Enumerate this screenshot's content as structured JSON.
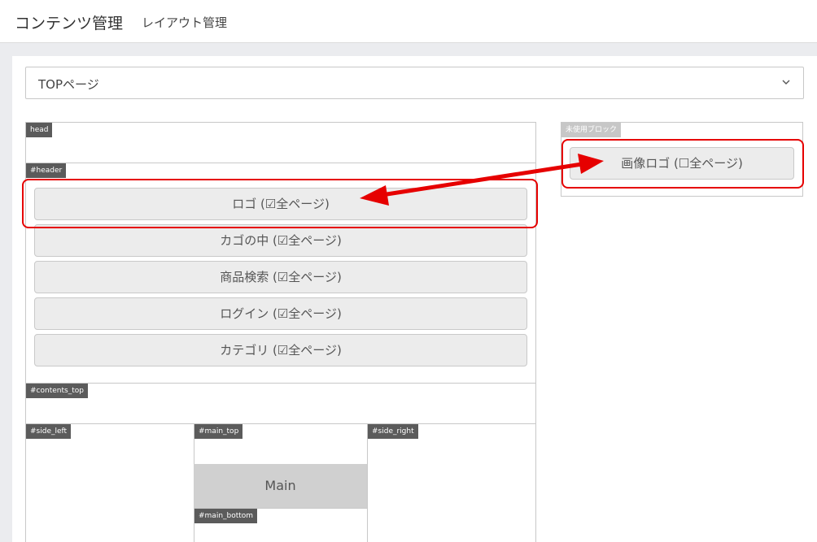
{
  "header": {
    "title": "コンテンツ管理",
    "subtitle": "レイアウト管理"
  },
  "page_select": {
    "value": "TOPページ"
  },
  "areas": {
    "head": "head",
    "header": "#header",
    "contents_top": "#contents_top",
    "side_left": "#side_left",
    "main_top": "#main_top",
    "side_right": "#side_right",
    "main_bottom": "#main_bottom",
    "unused": "未使用ブロック"
  },
  "header_blocks": [
    "ロゴ (☑全ページ)",
    "カゴの中 (☑全ページ)",
    "商品検索 (☑全ページ)",
    "ログイン (☑全ページ)",
    "カテゴリ (☑全ページ)"
  ],
  "unused_blocks": [
    "画像ロゴ (☐全ページ)"
  ],
  "main_label": "Main",
  "colors": {
    "highlight": "#e60000",
    "tag": "#5b5b5b",
    "block_bg": "#ececec"
  }
}
